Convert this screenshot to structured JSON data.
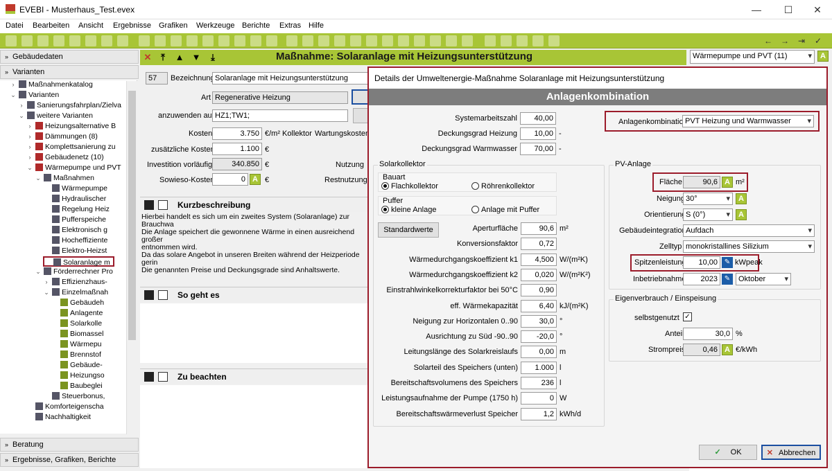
{
  "app": {
    "title": "EVEBI - Musterhaus_Test.evex"
  },
  "menu": [
    "Datei",
    "Bearbeiten",
    "Ansicht",
    "Ergebnisse",
    "Grafiken",
    "Werkzeuge",
    "Berichte",
    "Extras",
    "Hilfe"
  ],
  "left": {
    "h1": "Gebäudedaten",
    "h2": "Varianten",
    "h3": "Beratung",
    "h4": "Ergebnisse, Grafiken, Berichte",
    "tree": [
      "Maßnahmenkatalog",
      "Varianten",
      "Sanierungsfahrplan/Zielva",
      "weitere Varianten",
      "Heizungsalternative B",
      "Dämmungen (8)",
      "Komplettsanierung zu",
      "Gebäudenetz (10)",
      "Wärmepumpe und PVT",
      "Maßnahmen",
      "Wärmepumpe",
      "Hydraulischer",
      "Regelung Heiz",
      "Pufferspeiche",
      "Elektronisch g",
      "Hocheffiziente",
      "Elektro-Heizst",
      "Solaranlage m",
      "Förderrechner Pro",
      "Effizienzhaus-",
      "Einzelmaßnah",
      "Gebäudeh",
      "Anlagente",
      "Solarkolle",
      "Biomassel",
      "Wärmepu",
      "Brennstof",
      "Gebäude-",
      "Heizungso",
      "Baubeglei",
      "Steuerbonus,",
      "Komforteigenscha",
      "Nachhaltigkeit"
    ]
  },
  "main": {
    "title": "Maßnahme: Solaranlage mit Heizungsunterstützung",
    "variant_select": "Wärmepumpe und PVT (11)",
    "nr": "57",
    "bez_label": "Bezeichnung",
    "bez": "Solaranlage mit Heizungsunterstützung",
    "art_label": "Art",
    "art": "Regenerative Heizung",
    "anw_label": "anzuwenden auf",
    "anw": "HZ1;TW1;",
    "kosten_label": "Kosten",
    "kosten": "3.750",
    "kosten_unit": "€/m² Kollektor",
    "wartung_label": "Wartungskosten",
    "zus_label": "zusätzliche Kosten",
    "zus": "1.100",
    "inv_label": "Investition vorläufig",
    "inv": "340.850",
    "nutzung_label": "Nutzung",
    "sowieso_label": "Sowieso-Kosten",
    "sowieso": "0",
    "rest_label": "Restnutzung",
    "euro": "€",
    "kurz": "Kurzbeschreibung",
    "desc": [
      "Hierbei handelt es sich um ein zweites System (Solaranlage) zur Brauchwa",
      "Die Anlage speichert die gewonnene Wärme in einen ausreichend großer",
      "entnommen wird.",
      "Da das solare Angebot in unseren Breiten während der Heizperiode gerin",
      "Die genannten Preise und Deckungsgrade sind Anhaltswerte."
    ],
    "sogeht": "So geht es",
    "beachten": "Zu beachten"
  },
  "dialog": {
    "title": "Details der Umweltenergie-Maßnahme Solaranlage mit Heizungsunterstützung",
    "header": "Anlagenkombination",
    "top": [
      {
        "l": "Systemarbeitszahl",
        "v": "40,00",
        "u": ""
      },
      {
        "l": "Deckungsgrad Heizung",
        "v": "10,00",
        "u": "-"
      },
      {
        "l": "Deckungsgrad Warmwasser",
        "v": "70,00",
        "u": "-"
      }
    ],
    "kombi_label": "Anlagenkombination",
    "kombi": "PVT Heizung und Warmwasser",
    "sk": "Solarkollektor",
    "bauart": "Bauart",
    "flach": "Flachkollektor",
    "roehren": "Röhrenkollektor",
    "puffer": "Puffer",
    "klein": "kleine Anlage",
    "mitpuffer": "Anlage mit Puffer",
    "std": "Standardwerte",
    "rows": [
      {
        "l": "Aperturfläche",
        "v": "90,6",
        "u": "m²"
      },
      {
        "l": "Konversionsfaktor",
        "v": "0,72",
        "u": ""
      },
      {
        "l": "Wärmedurchgangskoeffizient k1",
        "v": "4,500",
        "u": "W/(m²K)"
      },
      {
        "l": "Wärmedurchgangskoeffizient k2",
        "v": "0,020",
        "u": "W/(m²K²)"
      },
      {
        "l": "Einstrahlwinkelkorrekturfaktor bei 50°C",
        "v": "0,90",
        "u": ""
      },
      {
        "l": "eff. Wärmekapazität",
        "v": "6,40",
        "u": "kJ/(m²K)"
      },
      {
        "l": "Neigung zur Horizontalen 0..90",
        "v": "30,0",
        "u": "°"
      },
      {
        "l": "Ausrichtung zu Süd -90..90",
        "v": "-20,0",
        "u": "°"
      },
      {
        "l": "Leitungslänge des Solarkreislaufs",
        "v": "0,00",
        "u": "m"
      },
      {
        "l": "Solarteil des Speichers (unten)",
        "v": "1.000",
        "u": "l"
      },
      {
        "l": "Bereitschaftsvolumens des Speichers",
        "v": "236",
        "u": "l"
      },
      {
        "l": "Leistungsaufnahme der Pumpe (1750 h)",
        "v": "0",
        "u": "W"
      },
      {
        "l": "Bereitschaftswärmeverlust Speicher",
        "v": "1,2",
        "u": "kWh/d"
      }
    ],
    "pv": "PV-Anlage",
    "flaeche_l": "Fläche",
    "flaeche": "90,6",
    "flaeche_u": "m²",
    "neig_l": "Neigung",
    "neig": "30°",
    "ori_l": "Orientierung",
    "ori": "S (0°)",
    "geb_l": "Gebäudeintegration",
    "geb": "Aufdach",
    "zell_l": "Zelltyp",
    "zell": "monokristallines Silizium",
    "spitze_l": "Spitzenleistung",
    "spitze": "10,00",
    "spitze_u": "kWpeak",
    "inbetrieb_l": "Inbetriebnahme",
    "jahr": "2023",
    "monat": "Oktober",
    "eigen": "Eigenverbrauch / Einspeisung",
    "selbst_l": "selbstgenutzt",
    "anteil_l": "Anteil",
    "anteil": "30,0",
    "anteil_u": "%",
    "strom_l": "Strompreis",
    "strom": "0,46",
    "strom_u": "€/kWh",
    "ok": "OK",
    "abbrechen": "Abbrechen",
    "a": "A"
  },
  "colors": {
    "accent": "#a8c536",
    "red": "#9b1b2a"
  }
}
